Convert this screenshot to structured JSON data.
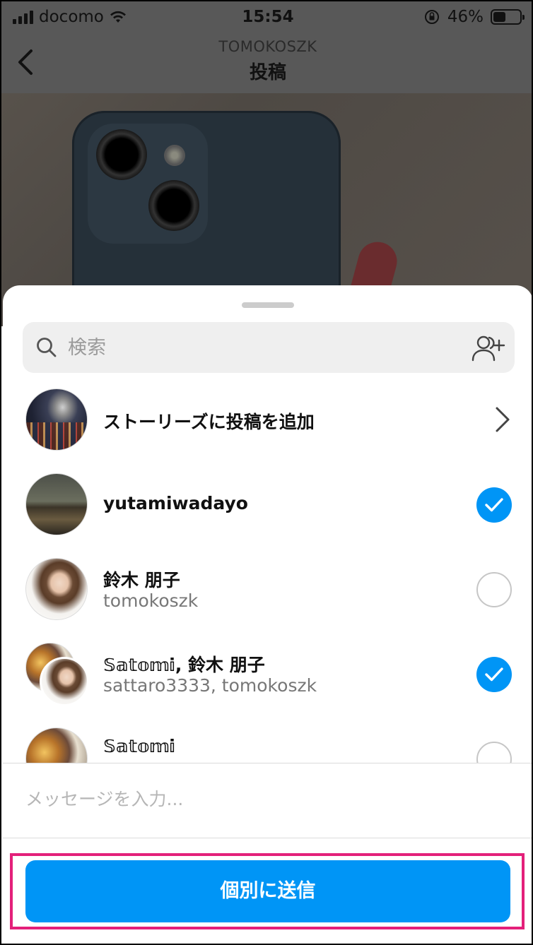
{
  "status_bar": {
    "carrier": "docomo",
    "time": "15:54",
    "battery": "46%",
    "battery_level": 0.46
  },
  "header": {
    "username": "TOMOKOSZK",
    "title": "投稿"
  },
  "share_sheet": {
    "search_placeholder": "検索",
    "story_row": {
      "label": "ストーリーズに投稿を追加"
    },
    "recipients": [
      {
        "name": "yutamiwadayo",
        "username": "",
        "selected": true
      },
      {
        "name": "鈴木 朋子",
        "username": "tomokoszk",
        "selected": false
      },
      {
        "name": "𝕊𝕒𝕥𝕠𝕞𝕚, 鈴木 朋子",
        "username": "sattaro3333, tomokoszk",
        "selected": true
      },
      {
        "name": "𝕊𝕒𝕥𝕠𝕞𝕚",
        "username": "",
        "selected": false
      }
    ],
    "message_placeholder": "メッセージを入力...",
    "send_button_label": "個別に送信"
  },
  "colors": {
    "accent": "#0095f6",
    "highlight": "#e3207a"
  }
}
